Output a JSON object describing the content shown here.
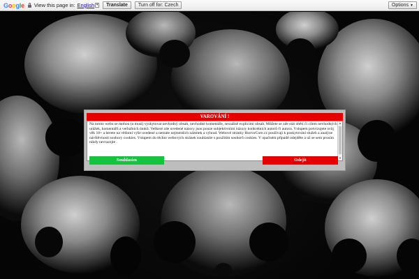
{
  "translate_bar": {
    "logo": [
      "G",
      "o",
      "o",
      "g",
      "l",
      "e"
    ],
    "view_label": "View this page in:",
    "language": "English",
    "caret": "▾",
    "translate_button": "Translate",
    "turn_off_button": "Turn off for: Czech",
    "options_button": "Options",
    "options_caret": "▼"
  },
  "modal": {
    "title": "VAROVÁNÍ !",
    "text": "Na tomto webu se mohou (a musí) vyskytovat nevhodný obsah, nevhodné komentáře, sexuálně explicitní obsah. Můžete se zde stát obětí či cílem nevhodných urážek, komentářů a verbálních útoků. Veškeré zde uvedené názory jsou pouze subjektivními názory konkrétních autorů či autora. Vstupem potvrzujete svůj věk 18+ a berete na vědomí výše uvedené a nemáte nejmenších námitek a výhrad. Webové stránky HorrorCore.cz používají k poskytování služeb a analýze návštěvnosti soubory cookies. Vstupem do těchto webových stránek souhlasíte s použitím souborů cookies. V opačném případě odejděte a už se sem prosím nikdy nevracejte .",
    "scroll_up": "▲",
    "scroll_down": "▼",
    "agree_button": "Souhlasím",
    "leave_button": "Odejít"
  },
  "colors": {
    "header_red": "#e60000",
    "agree_green": "#15c33f",
    "leave_red": "#e60000"
  }
}
